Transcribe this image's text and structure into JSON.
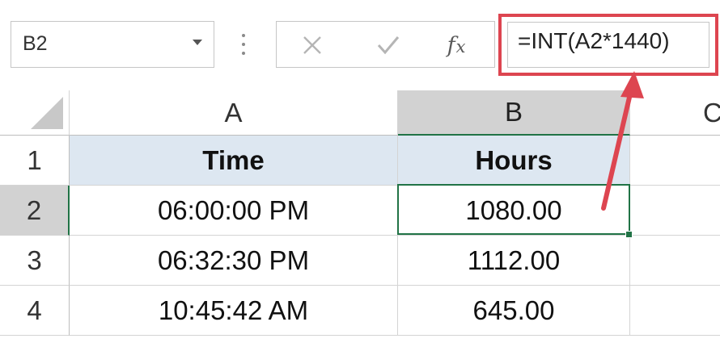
{
  "name_box": {
    "value": "B2"
  },
  "formula_bar": {
    "cancel_icon": "x-icon",
    "enter_icon": "check-icon",
    "fx_label": "f",
    "fx_sub": "x",
    "formula": "=INT(A2*1440)"
  },
  "columns": [
    "A",
    "B",
    "C"
  ],
  "rows": [
    "1",
    "2",
    "3",
    "4"
  ],
  "table": {
    "headers": [
      "Time",
      "Hours"
    ],
    "data": [
      [
        "06:00:00 PM",
        "1080.00"
      ],
      [
        "06:32:30 PM",
        "1112.00"
      ],
      [
        "10:45:42 AM",
        "645.00"
      ]
    ]
  },
  "selected_cell": "B2",
  "colors": {
    "annotation_red": "#dd4550",
    "selection_green": "#217346",
    "header_fill": "#dde7f1"
  }
}
